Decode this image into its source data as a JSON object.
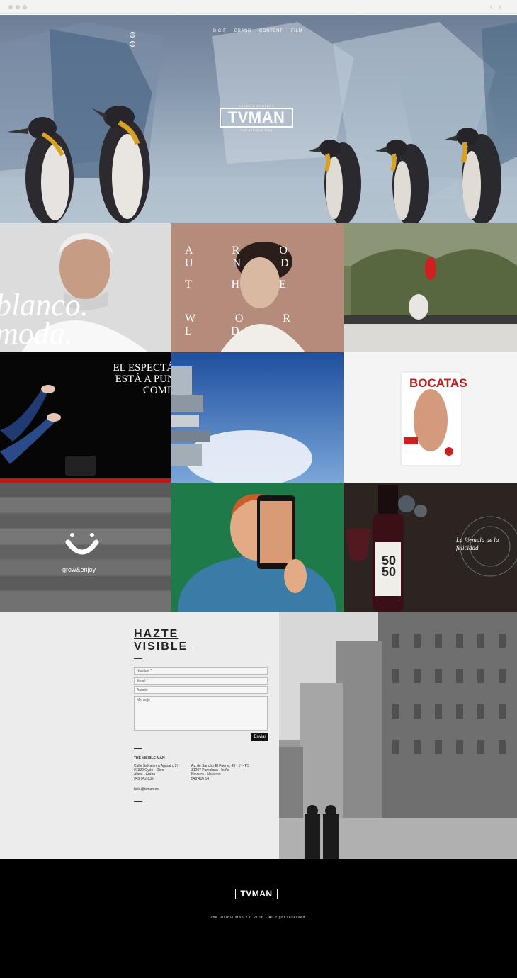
{
  "nav": {
    "items": [
      "B C F",
      "BRAND",
      "CONTENT",
      "FILM"
    ]
  },
  "social": {
    "icons": [
      "instagram-icon",
      "vimeo-icon"
    ],
    "glyphs": [
      "◎",
      "v"
    ]
  },
  "logo": {
    "top": "BRAND & CONTENT",
    "main": "TVMAN",
    "sub": "THE VISIBLE MAN"
  },
  "tiles": {
    "blanco_text": "blanco.\nmoda.",
    "around": [
      "A R O U N D",
      "T H E",
      "W O R L D"
    ],
    "espectaculo": [
      "EL ESPECTÁC",
      "ESTÁ A PUNT",
      "COMEN"
    ],
    "bocatas": "BOCATAS",
    "growenjoy": "grow&enjoy",
    "wine_label": "50 50",
    "felicidad": "La fórmula de la felicidad"
  },
  "contact": {
    "title_line1": "HAZTE",
    "title_line2": "VISIBLE",
    "fields": {
      "nombre": "Nombre *",
      "email": "Email *",
      "asunto": "Asunto",
      "mensaje": "Mensaje"
    },
    "send_label": "Enviar",
    "company": "THE VISIBLE MAN",
    "address1": [
      "Calle Salvatierra Agurain, 27",
      "01320 Oyón - Oion",
      "Álava - Araba",
      "945 042 832"
    ],
    "address2": [
      "Av. de Sancho El Fuerte, 49 - 1º - PS",
      "31007 Pamplona - Iruña",
      "Navarra - Nafarroa",
      "848 410 147"
    ],
    "email": "hola@tvman.es"
  },
  "footer": {
    "logo_main": "TVMAN",
    "copyright": "The Visible Man s.l. 2016 - All right reserved."
  },
  "colors": {
    "hero_sky": "#8597ad",
    "black": "#000000",
    "contact_bg": "#ececec",
    "green_bg": "#1f7a4a",
    "red_pepper": "#d11f1f"
  }
}
